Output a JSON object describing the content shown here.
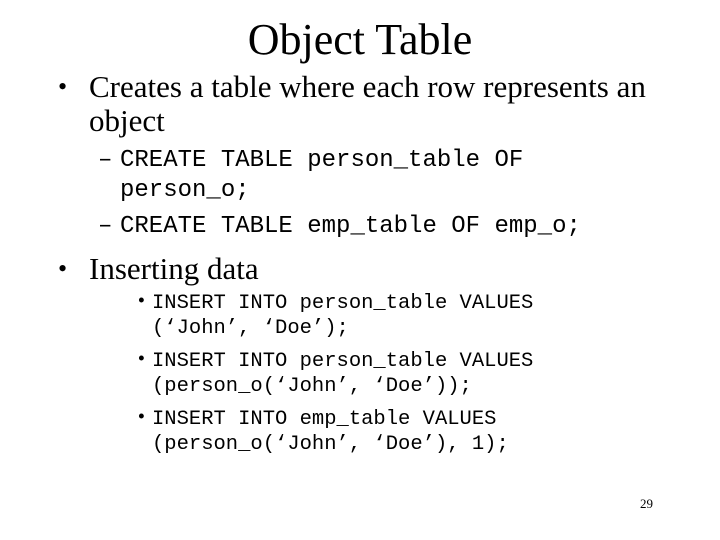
{
  "slide": {
    "title": "Object Table",
    "bullets": [
      {
        "marker": "•",
        "text": "Creates a table where each row represents an object",
        "subitems": [
          {
            "marker": "–",
            "text": "CREATE TABLE person_table OF person_o;"
          },
          {
            "marker": "–",
            "text": "CREATE TABLE emp_table OF emp_o;"
          }
        ]
      },
      {
        "marker": "•",
        "text": "Inserting data",
        "subitems": [
          {
            "marker": "•",
            "text": "INSERT INTO person_table VALUES (‘John’, ‘Doe’);"
          },
          {
            "marker": "•",
            "text": "INSERT INTO person_table VALUES (person_o(‘John’, ‘Doe’));"
          },
          {
            "marker": "•",
            "text": "INSERT INTO emp_table VALUES (person_o(‘John’, ‘Doe’), 1);"
          }
        ]
      }
    ],
    "page_number": "29"
  }
}
